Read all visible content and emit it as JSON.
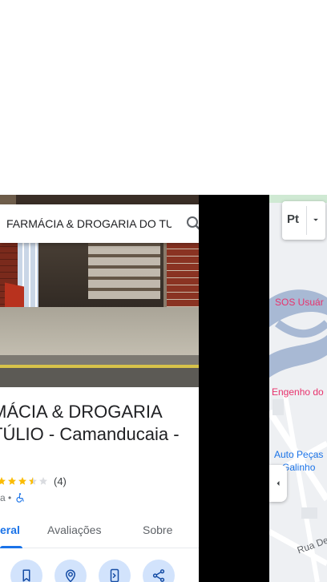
{
  "search": {
    "query": "FARMÁCIA & DROGARIA DO TU"
  },
  "place": {
    "title_line1": "MÁCIA & DROGARIA",
    "title_line2": "TÚLIO - Camanducaia -",
    "review_count": "(4)",
    "rating": 3.5,
    "meta_text": "a •"
  },
  "tabs": [
    {
      "label": "eral",
      "active": true
    },
    {
      "label": "Avaliações",
      "active": false
    },
    {
      "label": "Sobre",
      "active": false
    }
  ],
  "actions": [
    {
      "icon": "bookmark-icon"
    },
    {
      "icon": "nearby-icon"
    },
    {
      "icon": "send-to-phone-icon"
    },
    {
      "icon": "share-icon"
    }
  ],
  "map": {
    "layer_label": "Pt",
    "labels": [
      {
        "text": "SOS Usuár",
        "color": "#e8336d"
      },
      {
        "text": "Engenho do",
        "color": "#e8336d"
      },
      {
        "text": "Auto Peças",
        "color": "#1a73e8"
      },
      {
        "text": "n Galinho",
        "color": "#1a73e8"
      },
      {
        "text": "Rua De",
        "color": "#5f6368"
      }
    ]
  },
  "colors": {
    "accent": "#1a73e8",
    "action_bg": "#d2e3fc",
    "star": "#fbbc04"
  }
}
